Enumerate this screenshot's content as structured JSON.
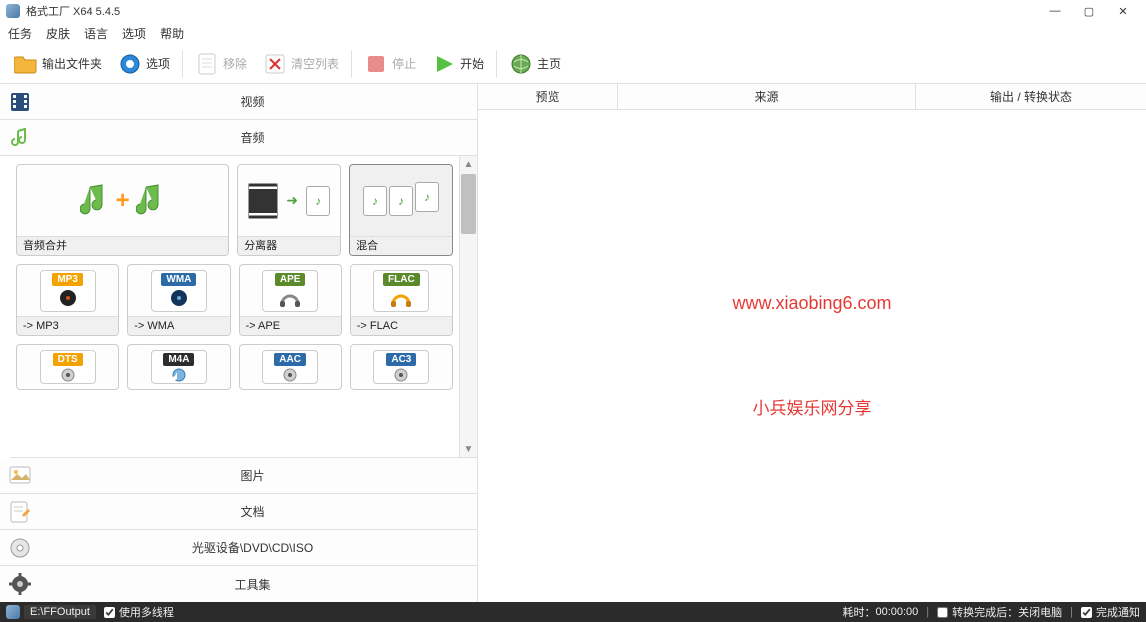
{
  "window": {
    "title": "格式工厂 X64 5.4.5"
  },
  "menu": {
    "items": [
      "任务",
      "皮肤",
      "语言",
      "选项",
      "帮助"
    ]
  },
  "toolbar": {
    "output": "输出文件夹",
    "options": "选项",
    "remove": "移除",
    "clear": "清空列表",
    "stop": "停止",
    "start": "开始",
    "home": "主页"
  },
  "categories": {
    "video": "视频",
    "audio": "音频",
    "image": "图片",
    "doc": "文档",
    "disc": "光驱设备\\DVD\\CD\\ISO",
    "tools": "工具集"
  },
  "tiles": {
    "audioJoin": "音频合并",
    "splitter": "分离器",
    "mix": "混合",
    "mp3": {
      "badge": "MP3",
      "label": "-> MP3",
      "color": "#f4a200"
    },
    "wma": {
      "badge": "WMA",
      "label": "-> WMA",
      "color": "#2d6aa8"
    },
    "ape": {
      "badge": "APE",
      "label": "-> APE",
      "color": "#5b8a2a"
    },
    "flac": {
      "badge": "FLAC",
      "label": "-> FLAC",
      "color": "#5b8a2a"
    },
    "dts": {
      "badge": "DTS",
      "color": "#f4a200"
    },
    "m4a": {
      "badge": "M4A",
      "color": "#2d2d2d"
    },
    "aac": {
      "badge": "AAC",
      "color": "#2d6aa8"
    },
    "ac3": {
      "badge": "AC3",
      "color": "#2d6aa8"
    }
  },
  "columns": {
    "preview": "预览",
    "source": "来源",
    "output": "输出 / 转换状态"
  },
  "overlay": {
    "url": "www.xiaobing6.com",
    "text": "小兵娱乐网分享"
  },
  "status": {
    "output_path": "E:\\FFOutput",
    "multithread": "使用多线程",
    "elapsed_label": "耗时：",
    "elapsed_value": "00:00:00",
    "shutdown": "转换完成后：关闭电脑",
    "notify": "完成通知"
  }
}
